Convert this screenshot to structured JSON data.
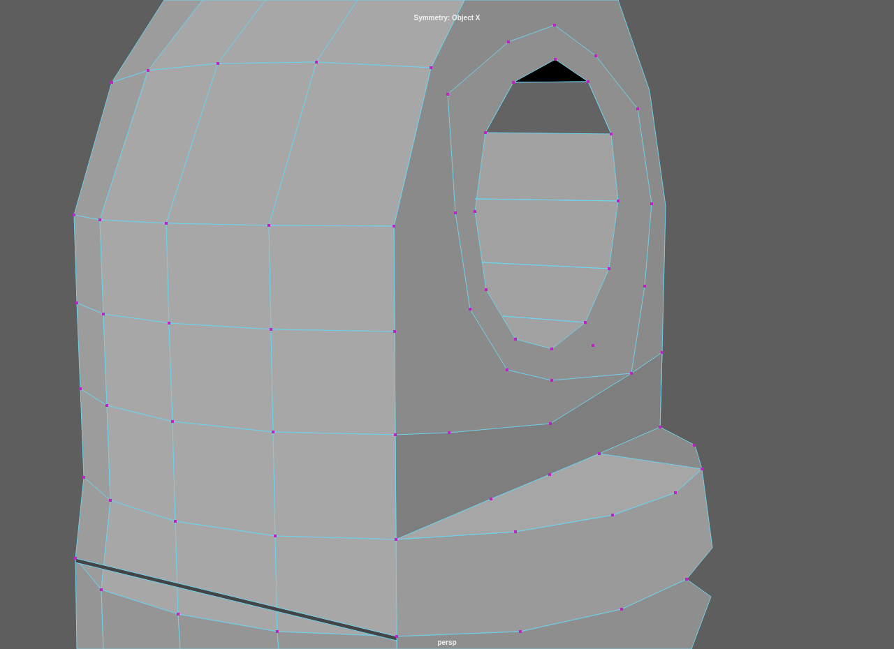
{
  "viewport": {
    "symmetry_label": "Symmetry: Object X",
    "camera_label": "persp"
  }
}
